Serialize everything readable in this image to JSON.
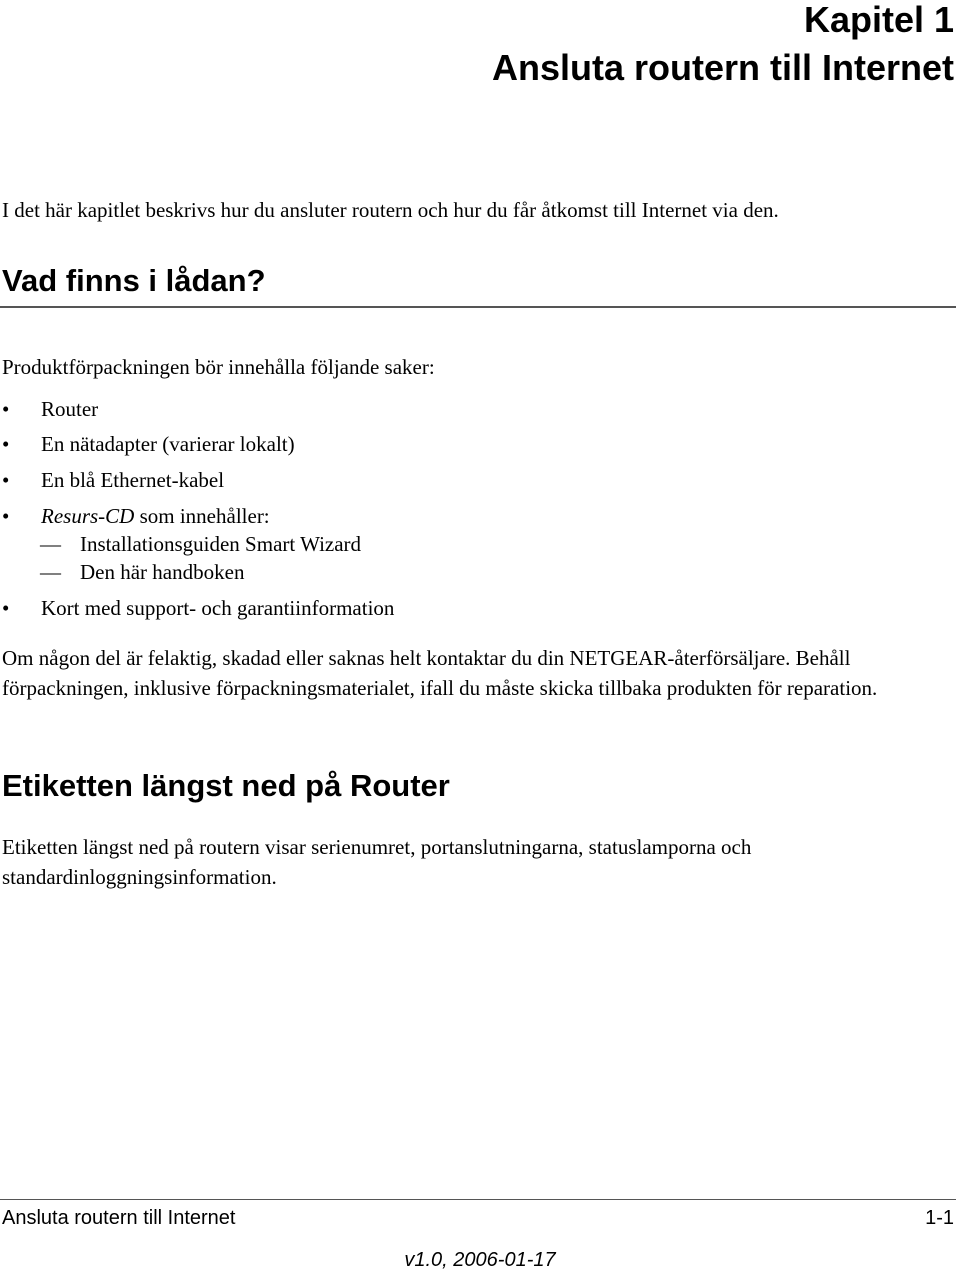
{
  "header": {
    "chapter_number": "Kapitel 1",
    "chapter_title": "Ansluta routern till Internet"
  },
  "intro": "I det här kapitlet beskrivs hur du ansluter routern och hur du får åtkomst till Internet via den.",
  "section1": {
    "heading": "Vad finns i lådan?",
    "lead": "Produktförpackningen bör innehålla följande saker:",
    "bullet_glyph": "•",
    "dash_glyph": "—",
    "items": [
      {
        "label": "Router"
      },
      {
        "label": "En nätadapter (varierar lokalt)"
      },
      {
        "label": "En blå Ethernet-kabel"
      },
      {
        "label_italic": "Resurs-CD",
        "label_rest": " som innehåller:",
        "subitems": [
          "Installationsguiden Smart Wizard",
          "Den här handboken"
        ]
      },
      {
        "label": "Kort med support- och garantiinformation"
      }
    ],
    "paragraph": "Om någon del är felaktig, skadad eller saknas helt kontaktar du din NETGEAR-återförsäljare. Behåll förpackningen, inklusive förpackningsmaterialet, ifall du måste skicka tillbaka produkten för reparation."
  },
  "section2": {
    "heading": "Etiketten längst ned på Router",
    "paragraph": "Etiketten längst ned på routern visar serienumret, portanslutningarna, statuslamporna och standardinloggningsinformation."
  },
  "footer": {
    "left": "Ansluta routern till Internet",
    "page": "1-1",
    "version": "v1.0, 2006-01-17"
  }
}
